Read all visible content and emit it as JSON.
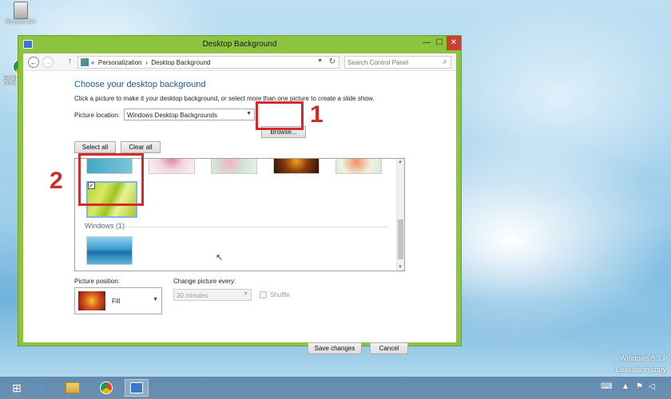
{
  "desktop": {
    "icons": [
      {
        "label": "Recycle Bin",
        "icon": "recycle-bin-icon"
      },
      {
        "label": "Google Chrome",
        "icon": "chrome-icon"
      }
    ],
    "watermark": {
      "line1": "Windows 8.1 P",
      "line2": "Evaluation copy."
    }
  },
  "window": {
    "title": "Desktop Background",
    "controls": {
      "min": "—",
      "max": "☐",
      "close": "✕"
    }
  },
  "addressbar": {
    "back": "←",
    "forward": "→",
    "up": "↑",
    "path_prefix": "«",
    "path": [
      "Personalization",
      "Desktop Background"
    ],
    "path_sep": "›",
    "search_placeholder": "Search Control Panel"
  },
  "main": {
    "heading": "Choose your desktop background",
    "description": "Click a picture to make it your desktop background, or select more than one picture to create a slide show.",
    "picture_location_label": "Picture location:",
    "picture_location_value": "Windows Desktop Backgrounds",
    "browse_label": "Browse...",
    "select_all_label": "Select all",
    "clear_all_label": "Clear all",
    "gallery": {
      "selected_checked": "✓",
      "group_label": "Windows (1)"
    },
    "picture_position_label": "Picture position:",
    "picture_position_value": "Fill",
    "change_picture_label": "Change picture every:",
    "change_picture_value": "30 minutes",
    "shuffle_label": "Shuffle",
    "save_label": "Save changes",
    "cancel_label": "Cancel"
  },
  "annotations": {
    "callout1": "1",
    "callout2": "2",
    "color": "#d42a2a"
  },
  "taskbar": {
    "items": [
      "windows-start-icon",
      "internet-explorer-icon",
      "file-explorer-icon",
      "chrome-icon",
      "control-panel-icon"
    ]
  },
  "colors": {
    "window_frame": "#8dc43f",
    "heading": "#1c5aa8",
    "close": "#c8422f"
  }
}
